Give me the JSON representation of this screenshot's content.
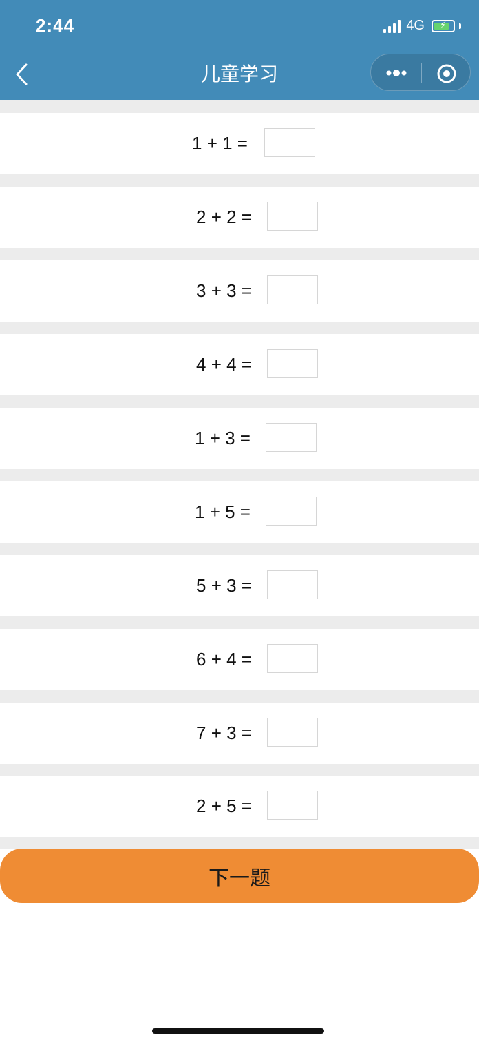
{
  "status_bar": {
    "time": "2:44",
    "network": "4G"
  },
  "nav": {
    "title": "儿童学习"
  },
  "questions": [
    {
      "text": "1 + 1 =",
      "answer": ""
    },
    {
      "text": "2 + 2 =",
      "answer": ""
    },
    {
      "text": "3 + 3 =",
      "answer": ""
    },
    {
      "text": "4 + 4 =",
      "answer": ""
    },
    {
      "text": "1 + 3 =",
      "answer": ""
    },
    {
      "text": "1 + 5 =",
      "answer": ""
    },
    {
      "text": "5 + 3 =",
      "answer": ""
    },
    {
      "text": "6 + 4 =",
      "answer": ""
    },
    {
      "text": "7 + 3 =",
      "answer": ""
    },
    {
      "text": "2 + 5 =",
      "answer": ""
    }
  ],
  "actions": {
    "next_label": "下一题"
  },
  "colors": {
    "header": "#428bb8",
    "button": "#ef8c34",
    "separator": "#ececec"
  },
  "icons": [
    "back-icon",
    "more-icon",
    "target-icon",
    "signal-icon",
    "battery-icon"
  ]
}
